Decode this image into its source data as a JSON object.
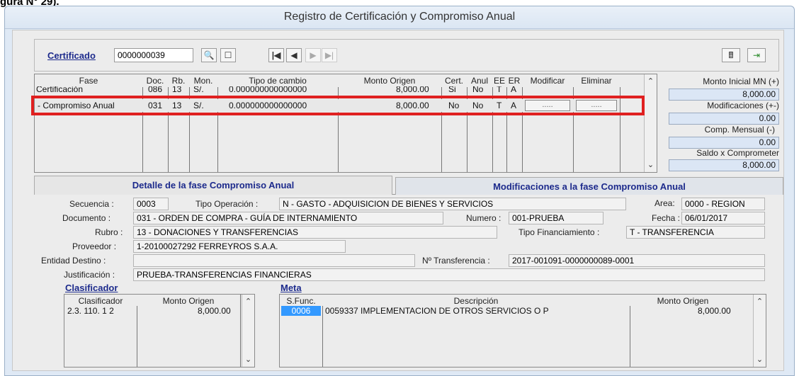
{
  "caption": "gura N° 29).",
  "window": {
    "title": "Registro de Certificación y Compromiso Anual"
  },
  "toolbar": {
    "certificado_label": "Certificado",
    "certificado_value": "0000000039",
    "buttons": [
      "binoculars-icon",
      "new-doc-icon",
      "first-icon",
      "prev-icon",
      "next-icon",
      "last-icon"
    ]
  },
  "grid": {
    "headers": {
      "fase": "Fase",
      "doc": "Doc.",
      "rb": "Rb.",
      "mon": "Mon.",
      "tipo": "Tipo de cambio",
      "monto": "Monto Origen",
      "cert": "Cert.",
      "anul": "Anul",
      "ee": "EE",
      "er": "ER",
      "modificar": "Modificar",
      "eliminar": "Eliminar"
    },
    "rows": [
      {
        "fase": "Certificación",
        "doc": "086",
        "rb": "13",
        "mon": "S/.",
        "tipo": "0.000000000000000",
        "monto": "8,000.00",
        "cert": "Si",
        "anul": "No",
        "ee": "T",
        "er": "A",
        "mod": "",
        "eli": ""
      },
      {
        "fase": "- Compromiso Anual",
        "doc": "031",
        "rb": "13",
        "mon": "S/.",
        "tipo": "0.000000000000000",
        "monto": "8,000.00",
        "cert": "No",
        "anul": "No",
        "ee": "T",
        "er": "A",
        "mod": ".....",
        "eli": "....."
      }
    ]
  },
  "summary": {
    "monto_inicial_label": "Monto Inicial MN (+)",
    "monto_inicial": "8,000.00",
    "modificaciones_label": "Modificaciones (+-)",
    "modificaciones": "0.00",
    "comp_mensual_label": "Comp. Mensual (-)",
    "comp_mensual": "0.00",
    "saldo_label": "Saldo x Comprometer",
    "saldo": "8,000.00"
  },
  "tabs": {
    "detalle": "Detalle de la fase Compromiso Anual",
    "modificaciones": "Modificaciones a la fase Compromiso Anual"
  },
  "detail": {
    "secuencia_label": "Secuencia :",
    "secuencia": "0003",
    "tipo_op_label": "Tipo Operación :",
    "tipo_op": "N  - GASTO - ADQUISICION DE BIENES Y SERVICIOS",
    "area_label": "Area:",
    "area": "0000 - REGION",
    "documento_label": "Documento :",
    "documento": "031 - ORDEN DE COMPRA - GUÍA DE INTERNAMIENTO",
    "numero_label": "Numero :",
    "numero": "001-PRUEBA",
    "fecha_label": "Fecha :",
    "fecha": "06/01/2017",
    "rubro_label": "Rubro :",
    "rubro": "13 - DONACIONES Y TRANSFERENCIAS",
    "tipo_fin_label": "Tipo Financiamiento :",
    "tipo_fin": "T - TRANSFERENCIA",
    "proveedor_label": "Proveedor :",
    "proveedor": "1-20100027292  FERREYROS S.A.A.",
    "entidad_label": "Entidad Destino :",
    "entidad": "",
    "transferencia_label": "Nº Transferencia :",
    "transferencia": "2017-001091-0000000089-0001",
    "justificacion_label": "Justificación :",
    "justificacion": "PRUEBA-TRANSFERENCIAS FINANCIERAS"
  },
  "clasificador": {
    "title": "Clasificador",
    "headers": {
      "clasif": "Clasificador",
      "monto": "Monto Origen"
    },
    "rows": [
      {
        "clasif": "2.3. 110. 1 2",
        "monto": "8,000.00"
      }
    ]
  },
  "meta": {
    "title": "Meta",
    "headers": {
      "sfunc": "S.Func.",
      "desc": "Descripción",
      "monto": "Monto Origen"
    },
    "rows": [
      {
        "sfunc": "0006",
        "desc": "0059337  IMPLEMENTACION DE OTROS SERVICIOS O P",
        "monto": "8,000.00"
      }
    ]
  },
  "colors": {
    "highlight": "#e02020",
    "link": "#1c2a8c",
    "selection": "#3399ff"
  }
}
